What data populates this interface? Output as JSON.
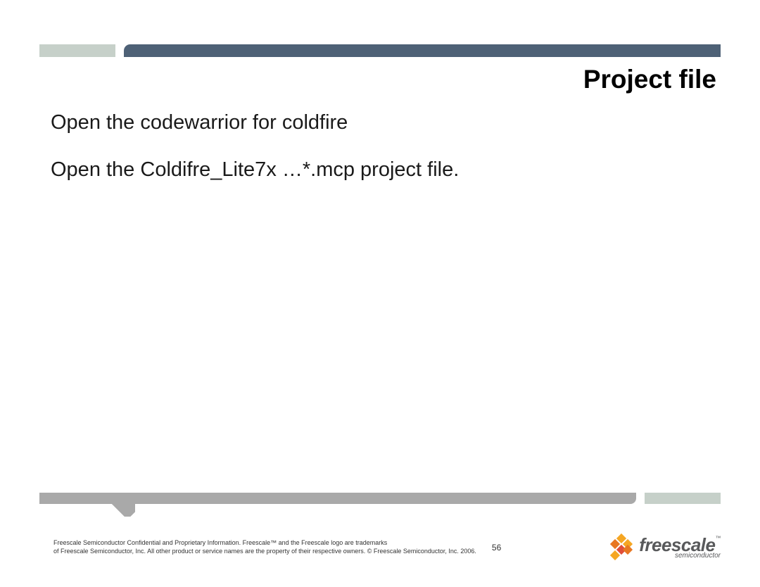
{
  "slide": {
    "title": "Project file",
    "lines": [
      "Open the codewarrior for coldfire",
      "Open the Coldifre_Lite7x …*.mcp project file."
    ]
  },
  "footer": {
    "legal_line1": "Freescale Semiconductor Confidential and Proprietary Information. Freescale™ and the Freescale logo are trademarks",
    "legal_line2": "of Freescale Semiconductor, Inc. All other product or service names are the property of their respective owners. © Freescale Semiconductor, Inc. 2006.",
    "page_number": "56"
  },
  "logo": {
    "brand": "freescale",
    "tm": "™",
    "sub": "semiconductor"
  }
}
